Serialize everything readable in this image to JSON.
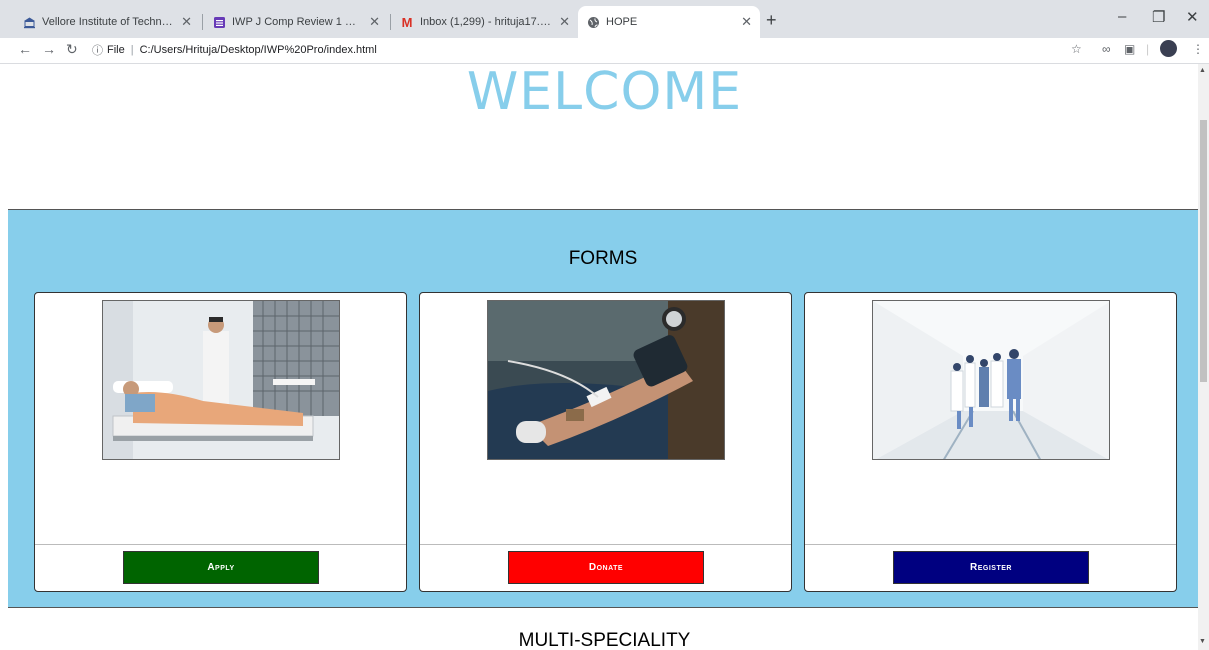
{
  "tabs": [
    {
      "title": "Vellore Institute of Technology (V",
      "icon": "university-icon"
    },
    {
      "title": "IWP J Comp Review 1 Report",
      "icon": "forms-icon"
    },
    {
      "title": "Inbox (1,299) - hrituja17.hs@gma",
      "icon": "gmail-icon"
    },
    {
      "title": "HOPE",
      "icon": "globe-icon"
    }
  ],
  "address": {
    "prefix": "File",
    "url": "C:/Users/Hrituja/Desktop/IWP%20Pro/index.html"
  },
  "page": {
    "heading": "WELCOME",
    "forms_title": "FORMS",
    "cards": [
      {
        "button": "Apply",
        "color": "#006400",
        "image": "hospital-patient-image"
      },
      {
        "button": "Donate",
        "color": "#ff0000",
        "image": "blood-donation-image"
      },
      {
        "button": "Register",
        "color": "#000080",
        "image": "hospital-corridor-image"
      }
    ],
    "next_section": "MULTI-SPECIALITY"
  },
  "colors": {
    "accent": "#87ceeb"
  }
}
